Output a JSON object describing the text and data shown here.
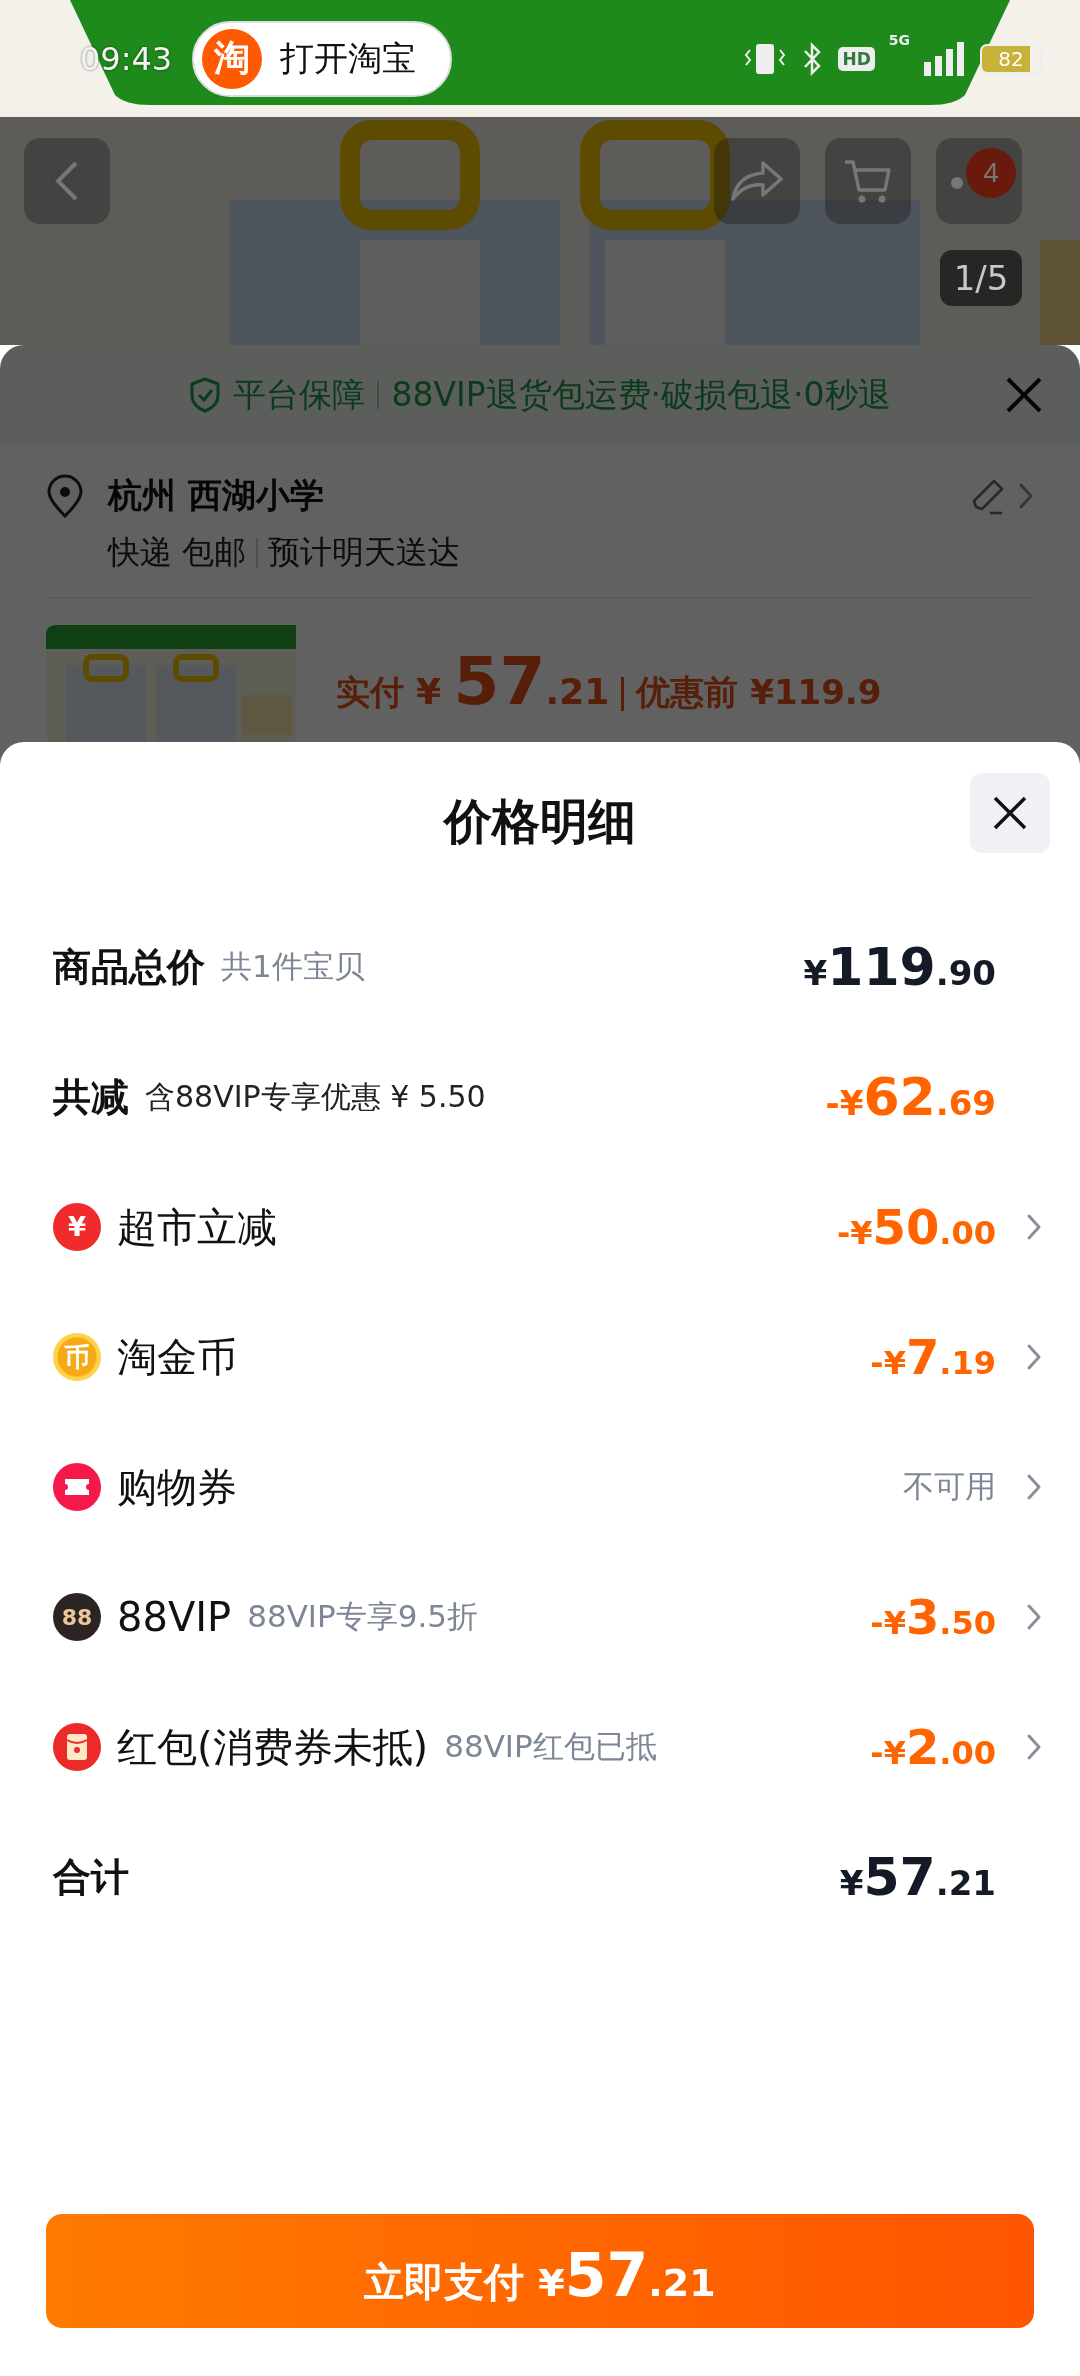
{
  "status_bar": {
    "time": "09:43",
    "app_pill": {
      "logo": "淘",
      "label": "打开淘宝"
    },
    "network_badge": "HD",
    "network_type": "5G",
    "battery": "82"
  },
  "product_nav": {
    "more_badge": "4",
    "image_counter": "1/5"
  },
  "order_sheet": {
    "guarantee_title": "平台保障",
    "guarantee_text": "88VIP退货包运费·破损包退·0秒退",
    "address": "杭州 西湖小学",
    "shipping": "快递 包邮",
    "delivery": "预计明天送达",
    "paid_label": "实付",
    "paid_price": "¥ 57.21",
    "before_label": "优惠前",
    "before_price": "¥119.9"
  },
  "price_sheet": {
    "title": "价格明细",
    "rows": [
      {
        "kind": "summary",
        "label": "商品总价",
        "note": "共1件宝贝",
        "amount": "¥119.90",
        "discount": false
      },
      {
        "kind": "summary",
        "label": "共减",
        "note": "含88VIP专享优惠 ¥ 5.50",
        "amount": "-¥62.69",
        "discount": true
      },
      {
        "kind": "reduction",
        "glyph": "¥",
        "label": "超市立减",
        "amount": "-¥50.00",
        "available": true
      },
      {
        "kind": "coins",
        "glyph": "币",
        "label": "淘金币",
        "amount": "-¥7.19",
        "available": true
      },
      {
        "kind": "coupon",
        "label": "购物券",
        "amount": "不可用",
        "available": false
      },
      {
        "kind": "membership",
        "glyph": "88",
        "label": "88VIP",
        "note": "88VIP专享9.5折",
        "amount": "-¥3.50",
        "available": true
      },
      {
        "kind": "envelope",
        "label": "红包(消费券未抵)",
        "note": "88VIP红包已抵",
        "amount": "-¥2.00",
        "available": true
      },
      {
        "kind": "total",
        "label": "合计",
        "amount": "¥57.21"
      }
    ],
    "pay_button": {
      "label": "立即支付",
      "price": "¥57.21"
    }
  }
}
